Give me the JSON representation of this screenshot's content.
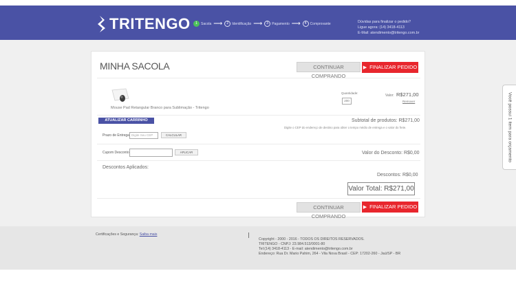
{
  "header": {
    "logo_text": "TRITENGO",
    "steps": [
      {
        "number": "1",
        "label": "Sacola",
        "active": true
      },
      {
        "number": "2",
        "label": "Identificação",
        "active": false
      },
      {
        "number": "3",
        "label": "Pagamento",
        "active": false
      },
      {
        "number": "4",
        "label": "Comprovante",
        "active": false
      }
    ],
    "arrow": "⟶",
    "help": {
      "line1": "Dúvidas para finalizar o pedido?",
      "line2": "Ligue agora: (14) 3418-4113",
      "line3": "E-Mail: atendimento@tritengo.com.br"
    }
  },
  "cart": {
    "title": "MINHA SACOLA",
    "continue_label": "CONTINUAR COMPRANDO",
    "checkout_label": "FINALIZAR PEDIDO",
    "product": {
      "name": "Mouse Pad Retangular Branco para Sublimação - Tritengo",
      "quantity_label": "Quantidade:",
      "quantity": "200",
      "price_label": "Valor:",
      "price": "R$271,00",
      "remove_label": "Remover"
    },
    "update_label": "ATUALIZAR CARRINHO",
    "subtotal": "Subtotal de produtos:   R$271,00",
    "shipping_hint": "Digite o CEP do endereço de destino para obter o tempo médio de entrega e o valor do frete.",
    "cep_label": "Prazo de Entrega:",
    "cep_placeholder": "Digite Seu CEP",
    "calculate_label": "CALCULAR",
    "coupon_label": "Cupom Desconto:",
    "coupon_value": "",
    "apply_label": "APLICAR",
    "discount_value": "Valor do Desconto:  R$0,00",
    "applied_label": "Descontos Aplicados:",
    "discounts": "Descontos:  R$0,00",
    "total": "Valor Total: R$271,00"
  },
  "side_tab": "Você possui 1 item para orçamento",
  "footer": {
    "cert_text": "Certificações e Segurança:",
    "cert_link": "Saiba mais",
    "copyright": "Copyright - 2000 - 2016 - TODOS OS DIREITOS RESERVADOS.",
    "company": "TRITENGO - CNPJ: 23.984.513/0001-80",
    "contact": "Tel:(14) 3418-4113 - E-mail: atendimento@tritengo.com.br",
    "address": "Endereço: Rua Dr. Mario Pahim, 264 - Vila Nova Brasil - CEP: 17202-260 - Jaú/SP - BR"
  },
  "colors": {
    "header_bg": "#4a52a5",
    "accent_red": "#e8262d",
    "step_active": "#4cc15a"
  }
}
